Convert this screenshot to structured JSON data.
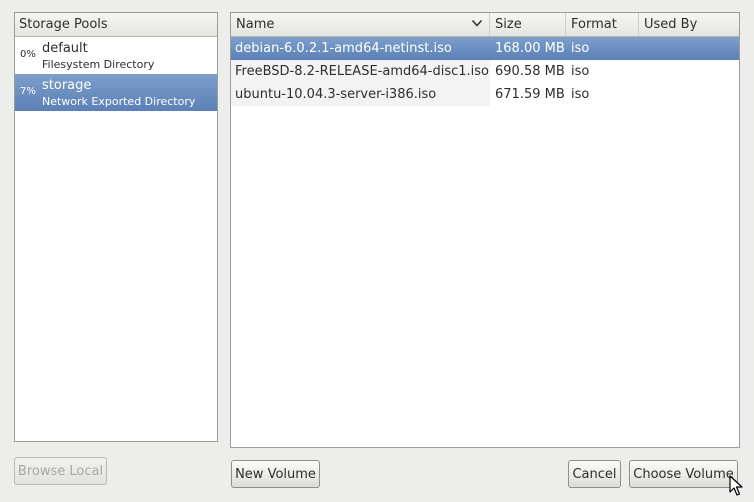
{
  "pools": {
    "header": "Storage Pools",
    "items": [
      {
        "usage": "0%",
        "name": "default",
        "type": "Filesystem Directory",
        "selected": false
      },
      {
        "usage": "7%",
        "name": "storage",
        "type": "Network Exported Directory",
        "selected": true
      }
    ]
  },
  "volumes": {
    "columns": {
      "name": "Name",
      "size": "Size",
      "format": "Format",
      "used_by": "Used By"
    },
    "sort_icon": "chevron-down-icon",
    "rows": [
      {
        "name": "debian-6.0.2.1-amd64-netinst.iso",
        "size": "168.00 MB",
        "format": "iso",
        "used_by": "",
        "selected": true
      },
      {
        "name": "FreeBSD-8.2-RELEASE-amd64-disc1.iso",
        "size": "690.58 MB",
        "format": "iso",
        "used_by": "",
        "selected": false
      },
      {
        "name": "ubuntu-10.04.3-server-i386.iso",
        "size": "671.59 MB",
        "format": "iso",
        "used_by": "",
        "selected": false
      }
    ]
  },
  "buttons": {
    "browse_local": "Browse Local",
    "new_volume": "New Volume",
    "cancel": "Cancel",
    "choose_volume": "Choose Volume"
  },
  "colors": {
    "selection": "#6a8dc0",
    "window_bg": "#ededeb"
  }
}
